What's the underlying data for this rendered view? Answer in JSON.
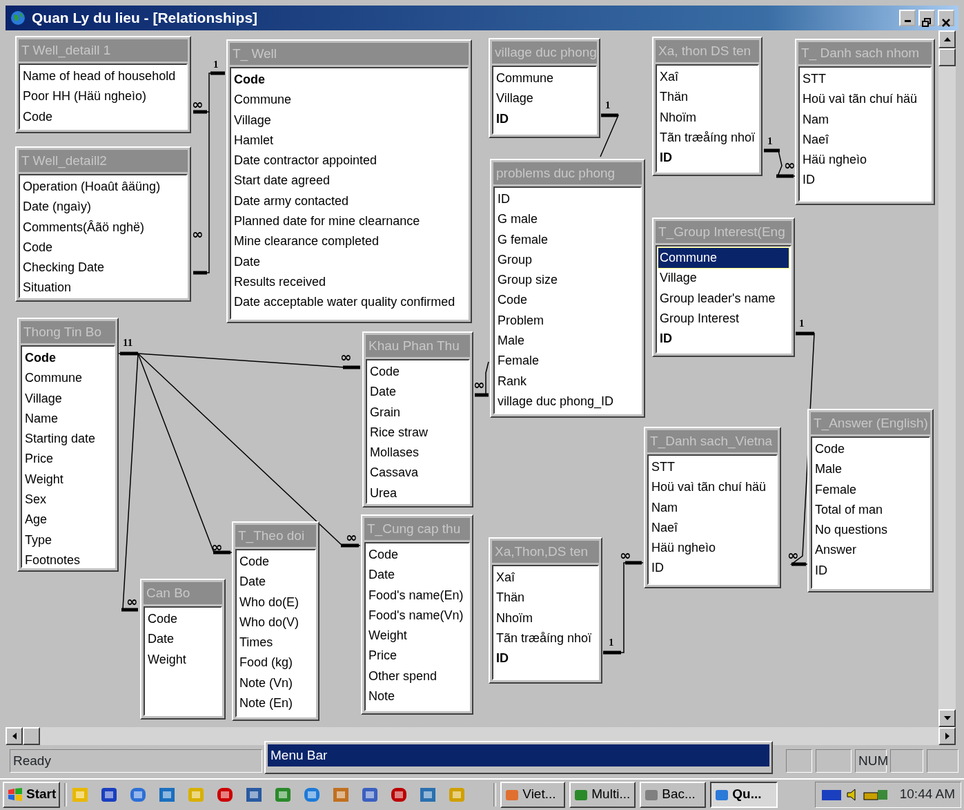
{
  "window": {
    "title": "Quan Ly du lieu - [Relationships]"
  },
  "tables": [
    {
      "title": "T Well_detaill 1",
      "fields": [
        {
          "name": "Name of head of household",
          "key": false,
          "selected": false
        },
        {
          "name": "Poor HH (Häü ngheìo)",
          "key": false,
          "selected": false
        },
        {
          "name": "Code",
          "key": false,
          "selected": false
        }
      ]
    },
    {
      "title": "T Well_detaill2",
      "fields": [
        {
          "name": "Operation (Hoaût âäüng)",
          "key": false,
          "selected": false
        },
        {
          "name": "Date (ngaìy)",
          "key": false,
          "selected": false
        },
        {
          "name": "Comments(Âãö nghë)",
          "key": false,
          "selected": false
        },
        {
          "name": "Code",
          "key": false,
          "selected": false
        },
        {
          "name": "Checking Date",
          "key": false,
          "selected": false
        },
        {
          "name": "Situation",
          "key": false,
          "selected": false
        }
      ]
    },
    {
      "title": "T_ Well",
      "fields": [
        {
          "name": "Code",
          "key": true,
          "selected": false
        },
        {
          "name": "Commune",
          "key": false,
          "selected": false
        },
        {
          "name": "Village",
          "key": false,
          "selected": false
        },
        {
          "name": "Hamlet",
          "key": false,
          "selected": false
        },
        {
          "name": "Date contractor appointed",
          "key": false,
          "selected": false
        },
        {
          "name": "Start date agreed",
          "key": false,
          "selected": false
        },
        {
          "name": "Date army contacted",
          "key": false,
          "selected": false
        },
        {
          "name": "Planned date for mine clearnance",
          "key": false,
          "selected": false
        },
        {
          "name": "Mine clearance completed",
          "key": false,
          "selected": false
        },
        {
          "name": "Date",
          "key": false,
          "selected": false
        },
        {
          "name": "Results received",
          "key": false,
          "selected": false
        },
        {
          "name": "Date acceptable water quality confirmed",
          "key": false,
          "selected": false
        }
      ]
    },
    {
      "title": "village duc phong",
      "fields": [
        {
          "name": "Commune",
          "key": false,
          "selected": false
        },
        {
          "name": "Village",
          "key": false,
          "selected": false
        },
        {
          "name": "ID",
          "key": true,
          "selected": false
        }
      ]
    },
    {
      "title": "problems duc phong",
      "fields": [
        {
          "name": "ID",
          "key": false,
          "selected": false
        },
        {
          "name": "G male",
          "key": false,
          "selected": false
        },
        {
          "name": "G female",
          "key": false,
          "selected": false
        },
        {
          "name": "Group",
          "key": false,
          "selected": false
        },
        {
          "name": "Group size",
          "key": false,
          "selected": false
        },
        {
          "name": "Code",
          "key": false,
          "selected": false
        },
        {
          "name": "Problem",
          "key": false,
          "selected": false
        },
        {
          "name": "Male",
          "key": false,
          "selected": false
        },
        {
          "name": "Female",
          "key": false,
          "selected": false
        },
        {
          "name": "Rank",
          "key": false,
          "selected": false
        },
        {
          "name": "village duc phong_ID",
          "key": false,
          "selected": false
        }
      ]
    },
    {
      "title": "Xa, thon DS ten",
      "fields": [
        {
          "name": "Xaî",
          "key": false,
          "selected": false
        },
        {
          "name": "Thän",
          "key": false,
          "selected": false
        },
        {
          "name": "Nhoïm",
          "key": false,
          "selected": false
        },
        {
          "name": "Tãn træåíng nhoï",
          "key": false,
          "selected": false
        },
        {
          "name": "ID",
          "key": true,
          "selected": false
        }
      ]
    },
    {
      "title": "T_ Danh sach nhom",
      "fields": [
        {
          "name": "STT",
          "key": false,
          "selected": false
        },
        {
          "name": "Hoü vaì  tãn chuí häü",
          "key": false,
          "selected": false
        },
        {
          "name": "Nam",
          "key": false,
          "selected": false
        },
        {
          "name": "Naeî",
          "key": false,
          "selected": false
        },
        {
          "name": "Häü ngheìo",
          "key": false,
          "selected": false
        },
        {
          "name": "ID",
          "key": false,
          "selected": false
        }
      ]
    },
    {
      "title": "T_Group Interest(Eng",
      "fields": [
        {
          "name": "Commune",
          "key": false,
          "selected": true
        },
        {
          "name": "Village",
          "key": false,
          "selected": false
        },
        {
          "name": "Group leader's name",
          "key": false,
          "selected": false
        },
        {
          "name": "Group Interest",
          "key": false,
          "selected": false
        },
        {
          "name": "ID",
          "key": true,
          "selected": false
        }
      ]
    },
    {
      "title": "Thong Tin Bo",
      "fields": [
        {
          "name": "Code",
          "key": true,
          "selected": false
        },
        {
          "name": "Commune",
          "key": false,
          "selected": false
        },
        {
          "name": "Village",
          "key": false,
          "selected": false
        },
        {
          "name": "Name",
          "key": false,
          "selected": false
        },
        {
          "name": "Starting date",
          "key": false,
          "selected": false
        },
        {
          "name": "Price",
          "key": false,
          "selected": false
        },
        {
          "name": "Weight",
          "key": false,
          "selected": false
        },
        {
          "name": "Sex",
          "key": false,
          "selected": false
        },
        {
          "name": "Age",
          "key": false,
          "selected": false
        },
        {
          "name": "Type",
          "key": false,
          "selected": false
        },
        {
          "name": "Footnotes",
          "key": false,
          "selected": false
        }
      ]
    },
    {
      "title": "Khau Phan Thu",
      "fields": [
        {
          "name": "Code",
          "key": false,
          "selected": false
        },
        {
          "name": "Date",
          "key": false,
          "selected": false
        },
        {
          "name": "Grain",
          "key": false,
          "selected": false
        },
        {
          "name": "Rice straw",
          "key": false,
          "selected": false
        },
        {
          "name": "Mollases",
          "key": false,
          "selected": false
        },
        {
          "name": "Cassava",
          "key": false,
          "selected": false
        },
        {
          "name": "Urea",
          "key": false,
          "selected": false
        }
      ]
    },
    {
      "title": "T_Danh sach_Vietna",
      "fields": [
        {
          "name": "STT",
          "key": false,
          "selected": false
        },
        {
          "name": "Hoü vaì  tãn chuí häü",
          "key": false,
          "selected": false
        },
        {
          "name": "Nam",
          "key": false,
          "selected": false
        },
        {
          "name": "Naeî",
          "key": false,
          "selected": false
        },
        {
          "name": "Häü ngheìo",
          "key": false,
          "selected": false
        },
        {
          "name": "ID",
          "key": false,
          "selected": false
        }
      ]
    },
    {
      "title": "T_Answer (English)",
      "fields": [
        {
          "name": "Code",
          "key": false,
          "selected": false
        },
        {
          "name": "Male",
          "key": false,
          "selected": false
        },
        {
          "name": "Female",
          "key": false,
          "selected": false
        },
        {
          "name": "Total of man",
          "key": false,
          "selected": false
        },
        {
          "name": "No questions",
          "key": false,
          "selected": false
        },
        {
          "name": "Answer",
          "key": false,
          "selected": false
        },
        {
          "name": "ID",
          "key": false,
          "selected": false
        }
      ]
    },
    {
      "title": "Can Bo",
      "fields": [
        {
          "name": "Code",
          "key": false,
          "selected": false
        },
        {
          "name": "Date",
          "key": false,
          "selected": false
        },
        {
          "name": "Weight",
          "key": false,
          "selected": false
        }
      ]
    },
    {
      "title": "T_Theo doi",
      "fields": [
        {
          "name": "Code",
          "key": false,
          "selected": false
        },
        {
          "name": "Date",
          "key": false,
          "selected": false
        },
        {
          "name": "Who do(E)",
          "key": false,
          "selected": false
        },
        {
          "name": "Who do(V)",
          "key": false,
          "selected": false
        },
        {
          "name": "Times",
          "key": false,
          "selected": false
        },
        {
          "name": "Food (kg)",
          "key": false,
          "selected": false
        },
        {
          "name": "Note (Vn)",
          "key": false,
          "selected": false
        },
        {
          "name": "Note (En)",
          "key": false,
          "selected": false
        }
      ]
    },
    {
      "title": "T_Cung cap thu",
      "fields": [
        {
          "name": "Code",
          "key": false,
          "selected": false
        },
        {
          "name": "Date",
          "key": false,
          "selected": false
        },
        {
          "name": "Food's name(En)",
          "key": false,
          "selected": false
        },
        {
          "name": "Food's name(Vn)",
          "key": false,
          "selected": false
        },
        {
          "name": "Weight",
          "key": false,
          "selected": false
        },
        {
          "name": "Price",
          "key": false,
          "selected": false
        },
        {
          "name": "Other spend",
          "key": false,
          "selected": false
        },
        {
          "name": "Note",
          "key": false,
          "selected": false
        }
      ]
    },
    {
      "title": "Xa,Thon,DS ten",
      "fields": [
        {
          "name": "Xaî",
          "key": false,
          "selected": false
        },
        {
          "name": "Thän",
          "key": false,
          "selected": false
        },
        {
          "name": "Nhoïm",
          "key": false,
          "selected": false
        },
        {
          "name": "Tãn træåíng nhoï",
          "key": false,
          "selected": false
        },
        {
          "name": "ID",
          "key": true,
          "selected": false
        }
      ]
    }
  ],
  "relationships": [
    {
      "one_label": "1",
      "many_label": "∞"
    },
    {
      "many_label": "∞"
    },
    {
      "one_label": "1"
    },
    {
      "one_label": "1",
      "many_label": "∞"
    },
    {
      "one_label": "1",
      "many_label": "∞"
    },
    {
      "one_label": "1",
      "many_label": "∞"
    },
    {
      "many_label": "∞"
    },
    {
      "one_label": "11",
      "many_label": "∞"
    },
    {
      "many_label": "∞"
    },
    {
      "many_label": "∞"
    },
    {
      "many_label": "∞"
    }
  ],
  "tooltip": {
    "text": "Menu Bar"
  },
  "status_bar": {
    "message": "Ready",
    "indicator": "NUM"
  },
  "taskbar": {
    "start": "Start",
    "tasks": [
      {
        "label": "Viet...",
        "selected": false
      },
      {
        "label": "Multi...",
        "selected": false
      },
      {
        "label": "Bac...",
        "selected": false
      },
      {
        "label": "Qu...",
        "selected": true
      }
    ],
    "clock": "10:44 AM"
  }
}
